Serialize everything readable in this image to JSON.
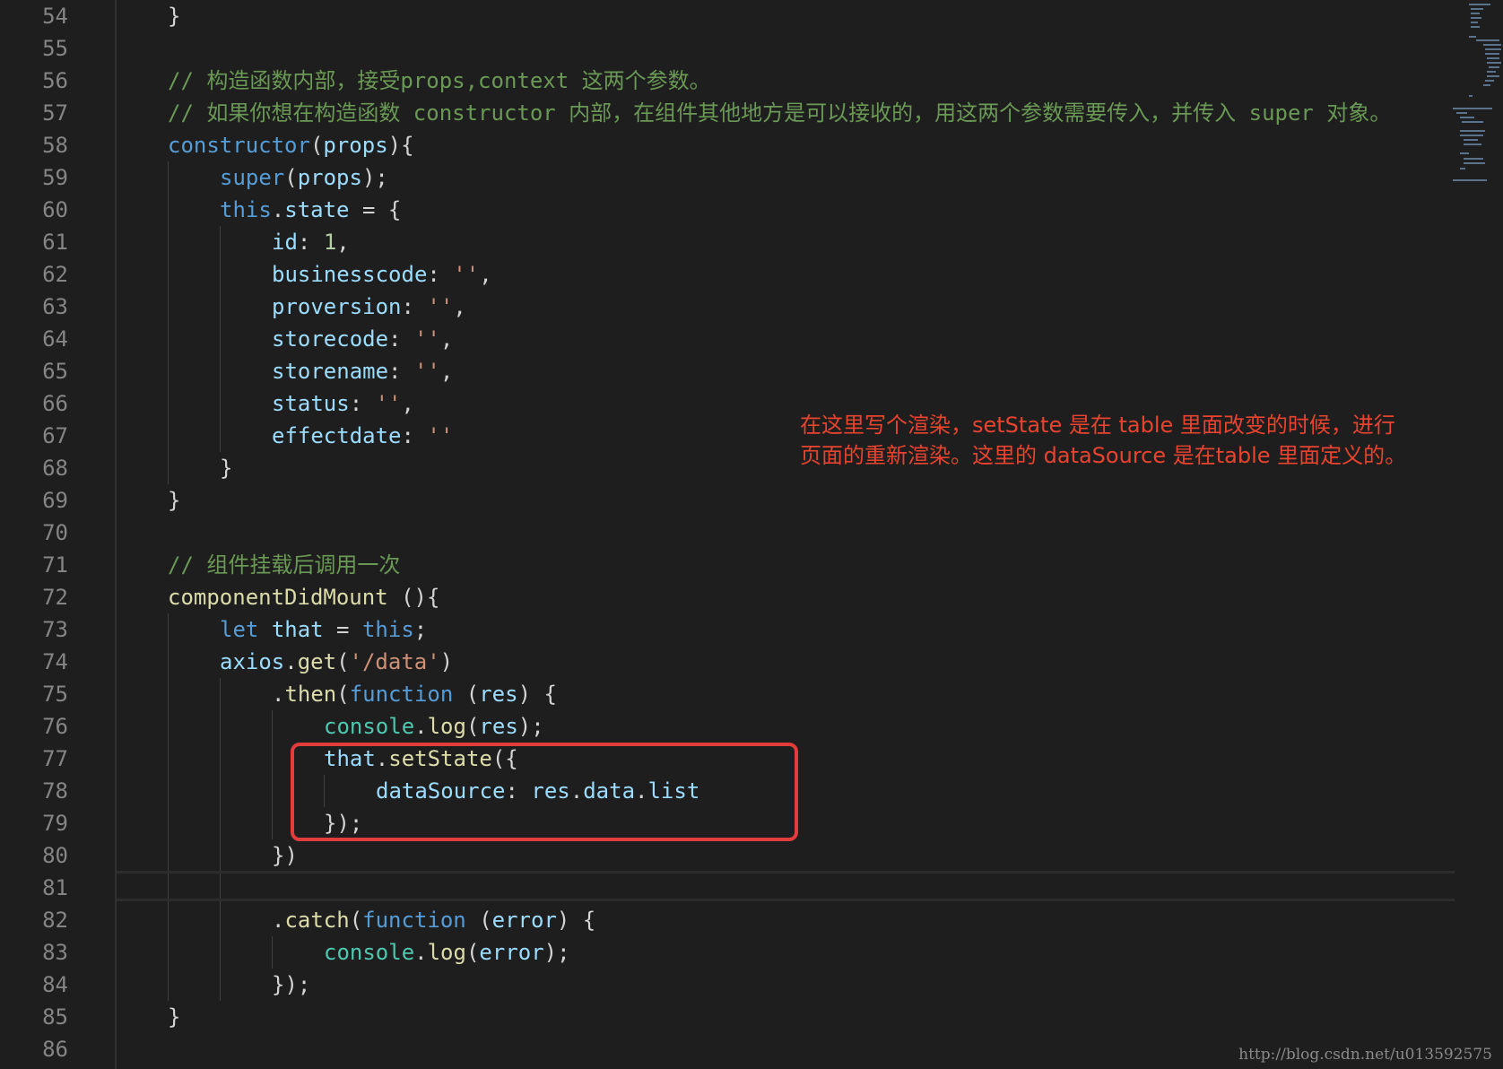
{
  "colors": {
    "background": "#1e1e1e",
    "comment": "#6a9955",
    "keyword": "#569cd6",
    "function": "#dcdcaa",
    "variable": "#9cdcfe",
    "number": "#b5cea8",
    "string": "#ce9178",
    "class": "#4ec9b0",
    "annotation": "#e8432f",
    "highlight_box": "#e23c3c",
    "line_number": "#858585"
  },
  "line_numbers": [
    "54",
    "55",
    "56",
    "57",
    "58",
    "59",
    "60",
    "61",
    "62",
    "63",
    "64",
    "65",
    "66",
    "67",
    "68",
    "69",
    "70",
    "71",
    "72",
    "73",
    "74",
    "75",
    "76",
    "77",
    "78",
    "79",
    "80",
    "81",
    "82",
    "83",
    "84",
    "85",
    "86"
  ],
  "code": {
    "l54": {
      "t1": "}"
    },
    "l56": {
      "t1": "// 构造函数内部，接受props,context 这两个参数。"
    },
    "l57": {
      "t1": "// 如果你想在构造函数 constructor 内部，在组件其他地方是可以接收的，用这两个参数需要传入，并传入 super 对象。"
    },
    "l58": {
      "t1": "constructor",
      "t2": "(",
      "t3": "props",
      "t4": "){"
    },
    "l59": {
      "t1": "super",
      "t2": "(",
      "t3": "props",
      "t4": ");"
    },
    "l60": {
      "t1": "this",
      "t2": ".",
      "t3": "state",
      "t4": " = {"
    },
    "l61": {
      "t1": "id",
      "t2": ": ",
      "t3": "1",
      "t4": ","
    },
    "l62": {
      "t1": "businesscode",
      "t2": ": ",
      "t3": "''",
      "t4": ","
    },
    "l63": {
      "t1": "proversion",
      "t2": ": ",
      "t3": "''",
      "t4": ","
    },
    "l64": {
      "t1": "storecode",
      "t2": ": ",
      "t3": "''",
      "t4": ","
    },
    "l65": {
      "t1": "storename",
      "t2": ": ",
      "t3": "''",
      "t4": ","
    },
    "l66": {
      "t1": "status",
      "t2": ": ",
      "t3": "''",
      "t4": ","
    },
    "l67": {
      "t1": "effectdate",
      "t2": ": ",
      "t3": "''"
    },
    "l68": {
      "t1": "}"
    },
    "l69": {
      "t1": "}"
    },
    "l71": {
      "t1": "// 组件挂载后调用一次"
    },
    "l72": {
      "t1": "componentDidMount",
      "t2": " (){"
    },
    "l73": {
      "t1": "let",
      "t2": " ",
      "t3": "that",
      "t4": " = ",
      "t5": "this",
      "t6": ";"
    },
    "l74": {
      "t1": "axios",
      "t2": ".",
      "t3": "get",
      "t4": "(",
      "t5": "'/data'",
      "t6": ")"
    },
    "l75": {
      "t1": ".",
      "t2": "then",
      "t3": "(",
      "t4": "function",
      "t5": " (",
      "t6": "res",
      "t7": ") {"
    },
    "l76": {
      "t1": "console",
      "t2": ".",
      "t3": "log",
      "t4": "(",
      "t5": "res",
      "t6": ");"
    },
    "l77": {
      "t1": "that",
      "t2": ".",
      "t3": "setState",
      "t4": "({"
    },
    "l78": {
      "t1": "dataSource",
      "t2": ": ",
      "t3": "res",
      "t4": ".",
      "t5": "data",
      "t6": ".",
      "t7": "list"
    },
    "l79": {
      "t1": "});"
    },
    "l80": {
      "t1": "})"
    },
    "l82": {
      "t1": ".",
      "t2": "catch",
      "t3": "(",
      "t4": "function",
      "t5": " (",
      "t6": "error",
      "t7": ") {"
    },
    "l83": {
      "t1": "console",
      "t2": ".",
      "t3": "log",
      "t4": "(",
      "t5": "error",
      "t6": ");"
    },
    "l84": {
      "t1": "});"
    },
    "l85": {
      "t1": "}"
    }
  },
  "annotation": {
    "line1": "在这里写个渲染，setState 是在 table 里面改变的时候，进行",
    "line2": "页面的重新渲染。这里的 dataSource 是在table 里面定义的。"
  },
  "watermark": "http://blog.csdn.net/u013592575"
}
